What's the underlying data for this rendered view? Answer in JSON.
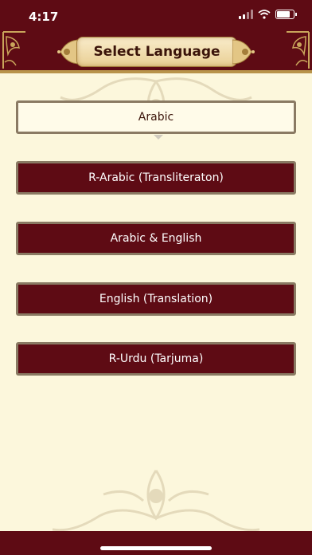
{
  "status": {
    "time": "4:17"
  },
  "header": {
    "title": "Select Language"
  },
  "languages": [
    {
      "label": "Arabic",
      "selected": true
    },
    {
      "label": "R-Arabic (Transliteraton)",
      "selected": false
    },
    {
      "label": "Arabic & English",
      "selected": false
    },
    {
      "label": "English (Translation)",
      "selected": false
    },
    {
      "label": "R-Urdu (Tarjuma)",
      "selected": false
    }
  ],
  "colors": {
    "maroon": "#5e0b14",
    "cream": "#fcf7dc",
    "gold": "#b8934a",
    "button_border": "#8a7a63"
  },
  "icons": {
    "signal": "signal-icon",
    "wifi": "wifi-icon",
    "battery": "battery-icon",
    "corner": "corner-ornament-icon",
    "scroll": "scroll-banner-icon"
  }
}
